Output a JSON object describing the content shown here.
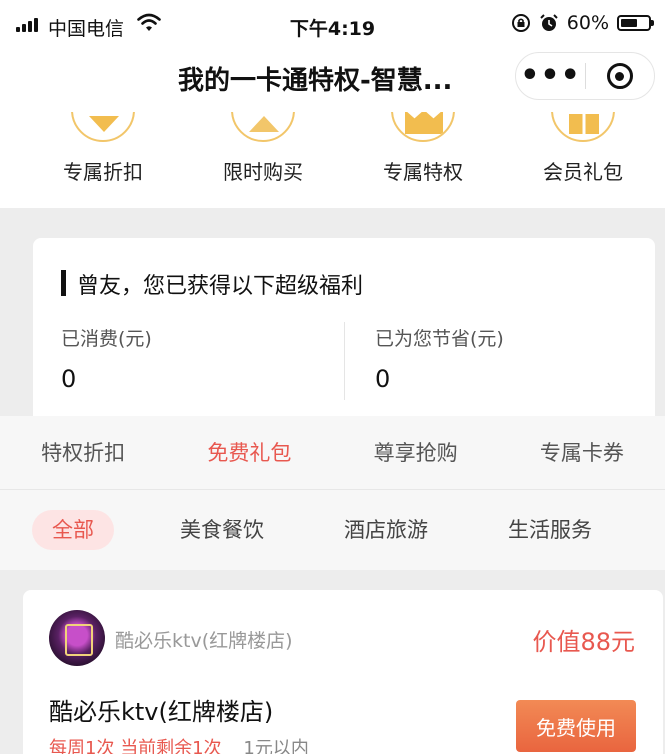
{
  "status_bar": {
    "carrier": "中国电信",
    "time": "下午4:19",
    "battery": "60%",
    "battery_level": 0.6
  },
  "nav": {
    "title": "我的一卡通特权-智慧..."
  },
  "quick_menu": [
    {
      "label": "专属折扣",
      "icon": "discount-icon"
    },
    {
      "label": "限时购买",
      "icon": "flash-sale-icon"
    },
    {
      "label": "专属特权",
      "icon": "crown-icon"
    },
    {
      "label": "会员礼包",
      "icon": "gift-box-icon"
    }
  ],
  "welfare": {
    "title": "曾友，您已获得以下超级福利",
    "spent_label": "已消费(元)",
    "spent_value": "0",
    "saved_label": "已为您节省(元)",
    "saved_value": "0"
  },
  "tabs": [
    "特权折扣",
    "免费礼包",
    "尊享抢购",
    "专属卡券"
  ],
  "active_tab": "免费礼包",
  "categories": [
    "全部",
    "美食餐饮",
    "酒店旅游",
    "生活服务"
  ],
  "active_category": "全部",
  "shop": {
    "name_small": "酷必乐ktv(红牌楼店)",
    "worth": "价值88元",
    "name": "酷必乐ktv(红牌楼店)",
    "weekly": "每周1次",
    "remaining": "当前剩余1次",
    "limit": "1元以内",
    "button": "免费使用"
  },
  "colors": {
    "accent": "#e8584f",
    "gold": "#f2c66a",
    "button": "#ec7149"
  }
}
